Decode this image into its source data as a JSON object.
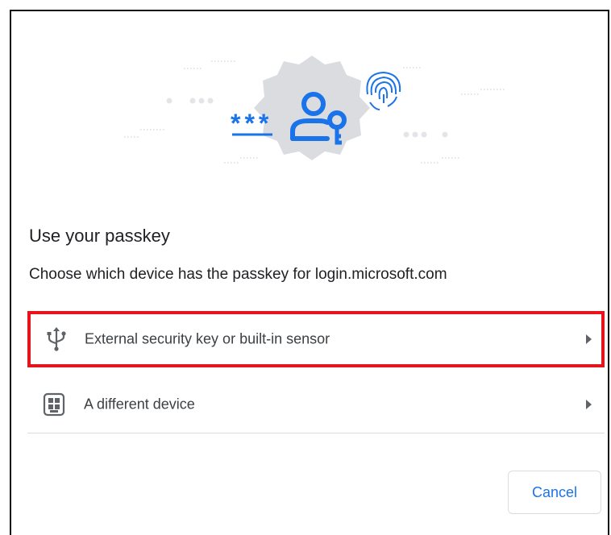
{
  "dialog": {
    "title": "Use your passkey",
    "subtitle": "Choose which device has the passkey for login.microsoft.com",
    "options": [
      {
        "label": "External security key or built-in sensor",
        "icon": "usb-icon",
        "selected": true
      },
      {
        "label": "A different device",
        "icon": "qr-phone-icon",
        "selected": false
      }
    ],
    "cancel_label": "Cancel",
    "illustration_password_mask": "***"
  },
  "colors": {
    "accent": "#1a73e8",
    "highlight": "#e8141c",
    "badge": "#dadce0"
  }
}
